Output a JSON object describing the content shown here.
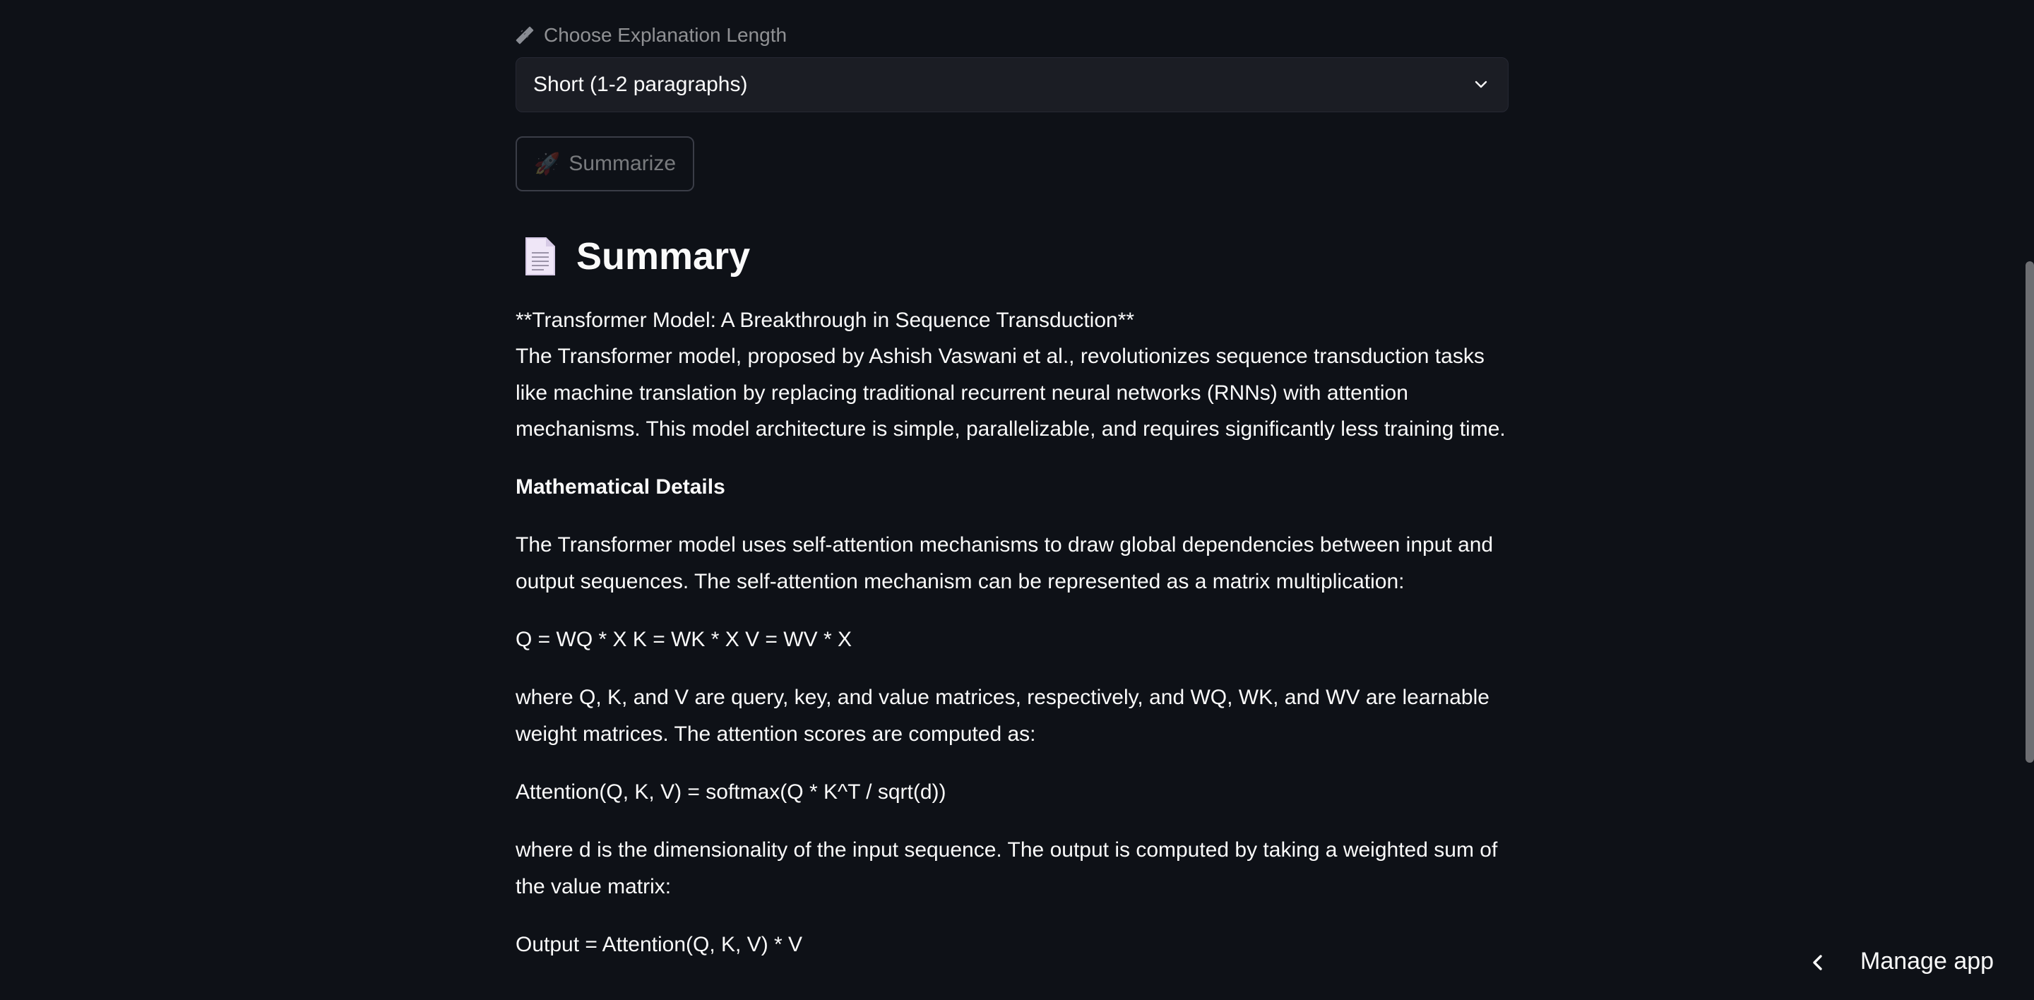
{
  "form": {
    "length_label": "Choose Explanation Length",
    "length_icon": "ruler-icon",
    "length_selected": "Short (1-2 paragraphs)",
    "summarize_label": "Summarize",
    "summarize_icon": "rocket-icon"
  },
  "summary": {
    "heading": "Summary",
    "heading_icon": "document-icon",
    "title_line": "**Transformer Model: A Breakthrough in Sequence Transduction**",
    "intro": "The Transformer model, proposed by Ashish Vaswani et al., revolutionizes sequence transduction tasks like machine translation by replacing traditional recurrent neural networks (RNNs) with attention mechanisms. This model architecture is simple, parallelizable, and requires significantly less training time.",
    "section_heading": "Mathematical Details",
    "para_self_attention": "The Transformer model uses self-attention mechanisms to draw global dependencies between input and output sequences. The self-attention mechanism can be represented as a matrix multiplication:",
    "equation_qkv": "Q = WQ * X K = WK * X V = WV * X",
    "para_matrices": "where Q, K, and V are query, key, and value matrices, respectively, and WQ, WK, and WV are learnable weight matrices. The attention scores are computed as:",
    "equation_attention": "Attention(Q, K, V) = softmax(Q * K^T / sqrt(d))",
    "para_output": "where d is the dimensionality of the input sequence. The output is computed by taking a weighted sum of the value matrix:",
    "equation_output": "Output = Attention(Q, K, V) * V"
  },
  "footer": {
    "manage_label": "Manage app"
  }
}
